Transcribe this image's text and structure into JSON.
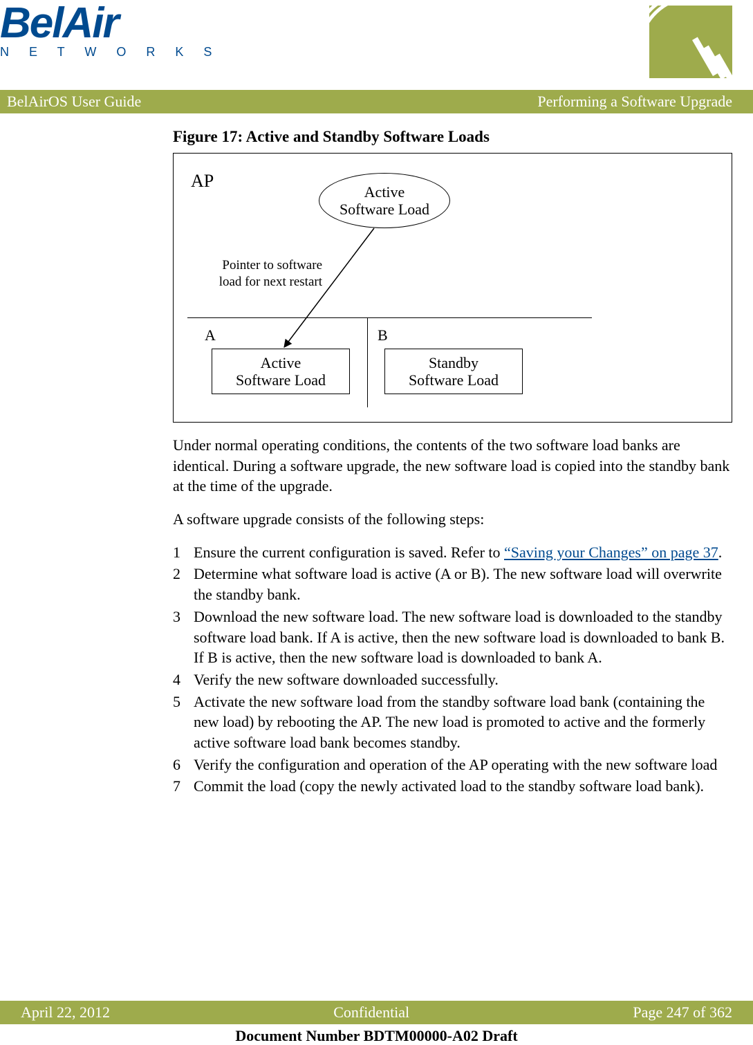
{
  "logo": {
    "main": "BelAir",
    "sub": "N E T W O R K S"
  },
  "title_bar": {
    "left": "BelAirOS User Guide",
    "right": "Performing a Software Upgrade"
  },
  "figure": {
    "caption": "Figure 17: Active and Standby Software Loads",
    "ap_label": "AP",
    "oval_line1": "Active",
    "oval_line2": "Software Load",
    "pointer_line1": "Pointer to software",
    "pointer_line2": "load for next restart",
    "bank_a": "A",
    "bank_b": "B",
    "box_a_line1": "Active",
    "box_a_line2": "Software Load",
    "box_b_line1": "Standby",
    "box_b_line2": "Software Load"
  },
  "para1": "Under normal operating conditions, the contents of the two software load banks are identical. During a software upgrade, the new software load is copied into the standby bank at the time of the upgrade.",
  "para2": "A software upgrade consists of the following steps:",
  "steps": {
    "s1_a": "Ensure the current configuration is saved. Refer to ",
    "s1_link": "“Saving your Changes” on page 37",
    "s1_b": ".",
    "s2": "Determine what software load is active (A or B). The new software load will overwrite the standby bank.",
    "s3": "Download the new software load. The new software load is downloaded to the standby software load bank. If A is active, then the new software load is downloaded to bank B. If B is active, then the new software load is downloaded to bank A.",
    "s4": "Verify the new software downloaded successfully.",
    "s5": "Activate the new software load from the standby software load bank (containing the new load) by rebooting the AP. The new load is promoted to active and the formerly active software load bank becomes standby.",
    "s6": "Verify the configuration and operation of the AP operating with the new software load",
    "s7": "Commit the load (copy the newly activated load to the standby software load bank)."
  },
  "footer": {
    "left": "April 22, 2012",
    "center": "Confidential",
    "right": "Page 247 of 362"
  },
  "doc_number": "Document Number BDTM00000-A02 Draft"
}
